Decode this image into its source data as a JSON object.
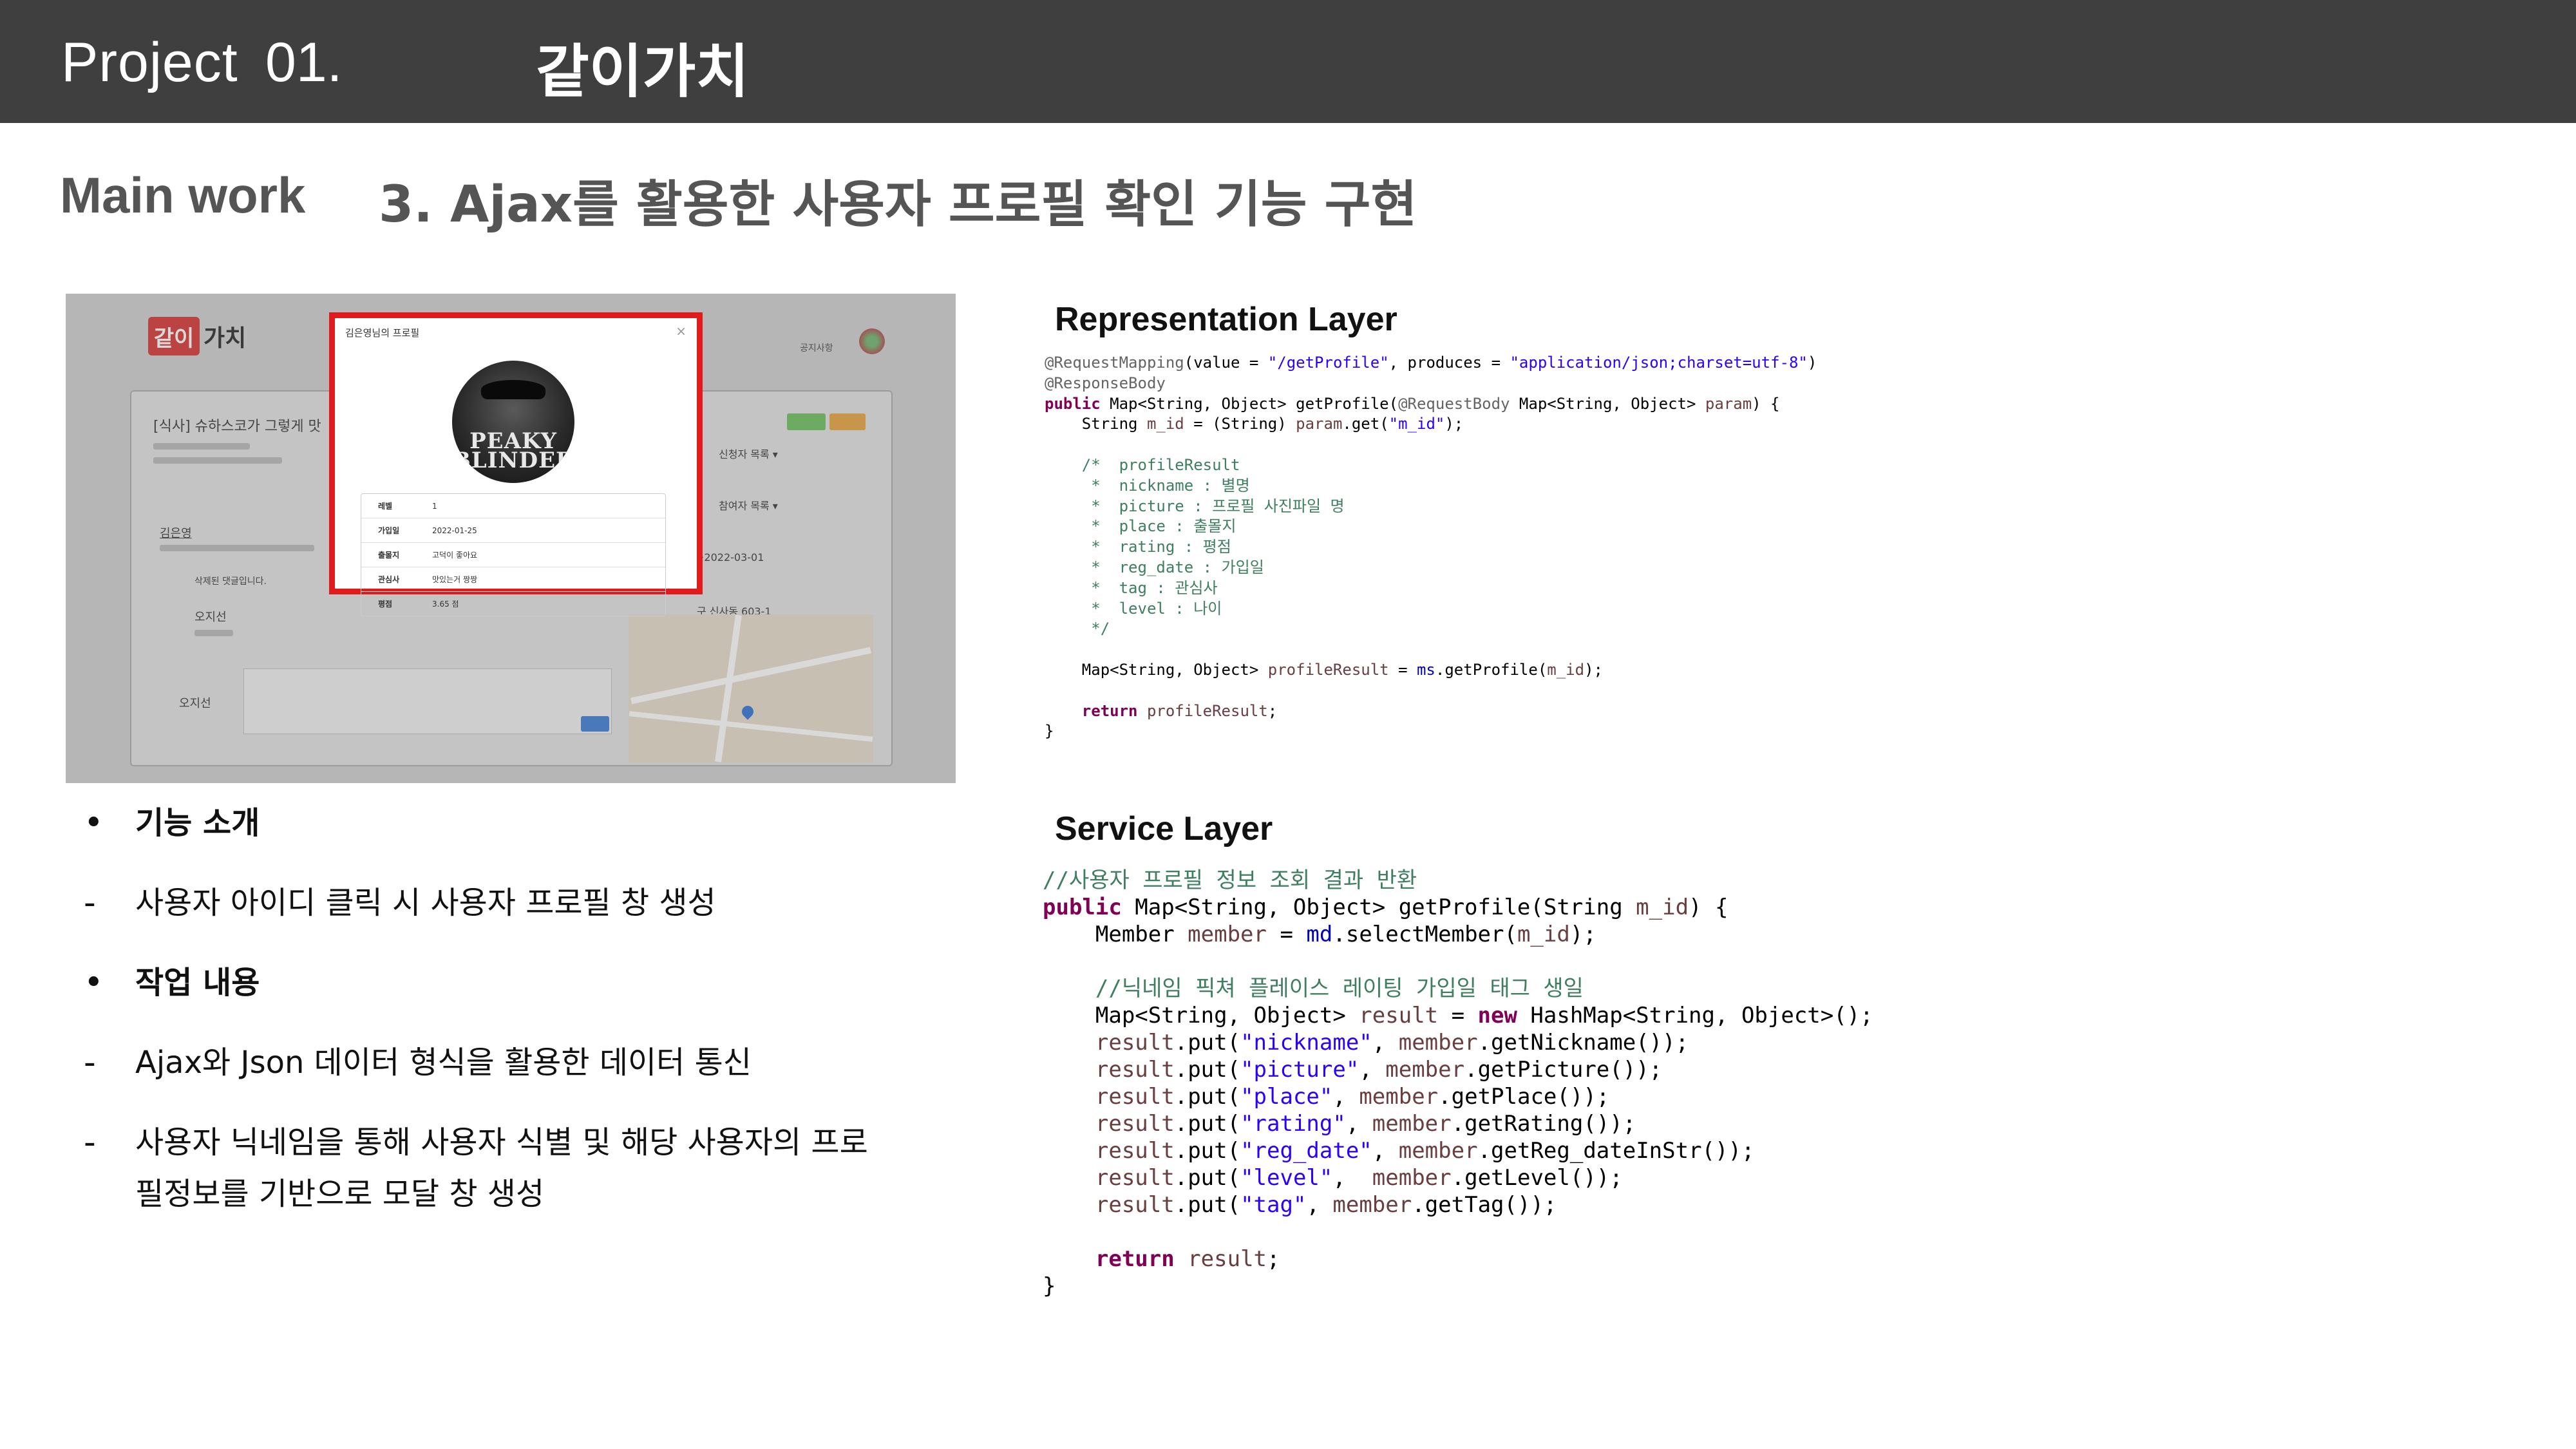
{
  "header": {
    "project_label": "Project",
    "project_number": "01.",
    "project_name": "같이가치"
  },
  "section": {
    "label": "Main work",
    "title": "3. Ajax를 활용한 사용자 프로필 확인 기능 구현"
  },
  "screenshot": {
    "logo_text": "가치",
    "logo_mark": "같이",
    "notice_link": "공지사항",
    "post_title": "[식사] 슈하스코가 그렇게 맛",
    "side_labels": [
      "신청자 목록 ▾",
      "참여자 목록 ▾",
      "~2022-03-01",
      "구 신사동 603-1"
    ],
    "commenters": [
      "김은영",
      "오지선",
      "오지선"
    ],
    "deleted_comment": "삭제된 댓글입니다.",
    "modal": {
      "title": "김은영님의 프로필",
      "close": "×",
      "avatar_text": "PEAKY BLINDERS",
      "rows": [
        {
          "key": "레벨",
          "value": "1"
        },
        {
          "key": "가입일",
          "value": "2022-01-25"
        },
        {
          "key": "출몰지",
          "value": "고덕이 좋아요"
        },
        {
          "key": "관심사",
          "value": "맛있는거 짱짱"
        },
        {
          "key": "평점",
          "value": "3.65 점"
        }
      ]
    }
  },
  "bullets": [
    {
      "marker": "•",
      "text": "기능 소개",
      "bold": true
    },
    {
      "marker": "-",
      "text": "사용자 아이디 클릭 시 사용자 프로필 창 생성",
      "bold": false
    },
    {
      "marker": "•",
      "text": "작업 내용",
      "bold": true
    },
    {
      "marker": "-",
      "text": "Ajax와 Json 데이터 형식을 활용한 데이터 통신",
      "bold": false
    },
    {
      "marker": "-",
      "text": "사용자 닉네임을 통해 사용자 식별 및 해당 사용자의 프로필정보를 기반으로 모달 창 생성",
      "bold": false
    }
  ],
  "representation": {
    "title": "Representation Layer",
    "code": [
      "@RequestMapping(value = \"/getProfile\", produces = \"application/json;charset=utf-8\")",
      "@ResponseBody",
      "public Map<String, Object> getProfile(@RequestBody Map<String, Object> param) {",
      "    String m_id = (String) param.get(\"m_id\");",
      "",
      "    /*  profileResult",
      "     *  nickname : 별명",
      "     *  picture : 프로필 사진파일 명",
      "     *  place : 출몰지",
      "     *  rating : 평점",
      "     *  reg_date : 가입일",
      "     *  tag : 관심사",
      "     *  level : 나이",
      "     */",
      "",
      "    Map<String, Object> profileResult = ms.getProfile(m_id);",
      "",
      "    return profileResult;",
      "}"
    ]
  },
  "service": {
    "title": "Service Layer",
    "code": [
      "//사용자 프로필 정보 조회 결과 반환",
      "public Map<String, Object> getProfile(String m_id) {",
      "    Member member = md.selectMember(m_id);",
      "",
      "    //닉네임 픽쳐 플레이스 레이팅 가입일 태그 생일",
      "    Map<String, Object> result = new HashMap<String, Object>();",
      "    result.put(\"nickname\", member.getNickname());",
      "    result.put(\"picture\", member.getPicture());",
      "    result.put(\"place\", member.getPlace());",
      "    result.put(\"rating\", member.getRating());",
      "    result.put(\"reg_date\", member.getReg_dateInStr());",
      "    result.put(\"level\",  member.getLevel());",
      "    result.put(\"tag\", member.getTag());",
      "",
      "    return result;",
      "}"
    ]
  }
}
